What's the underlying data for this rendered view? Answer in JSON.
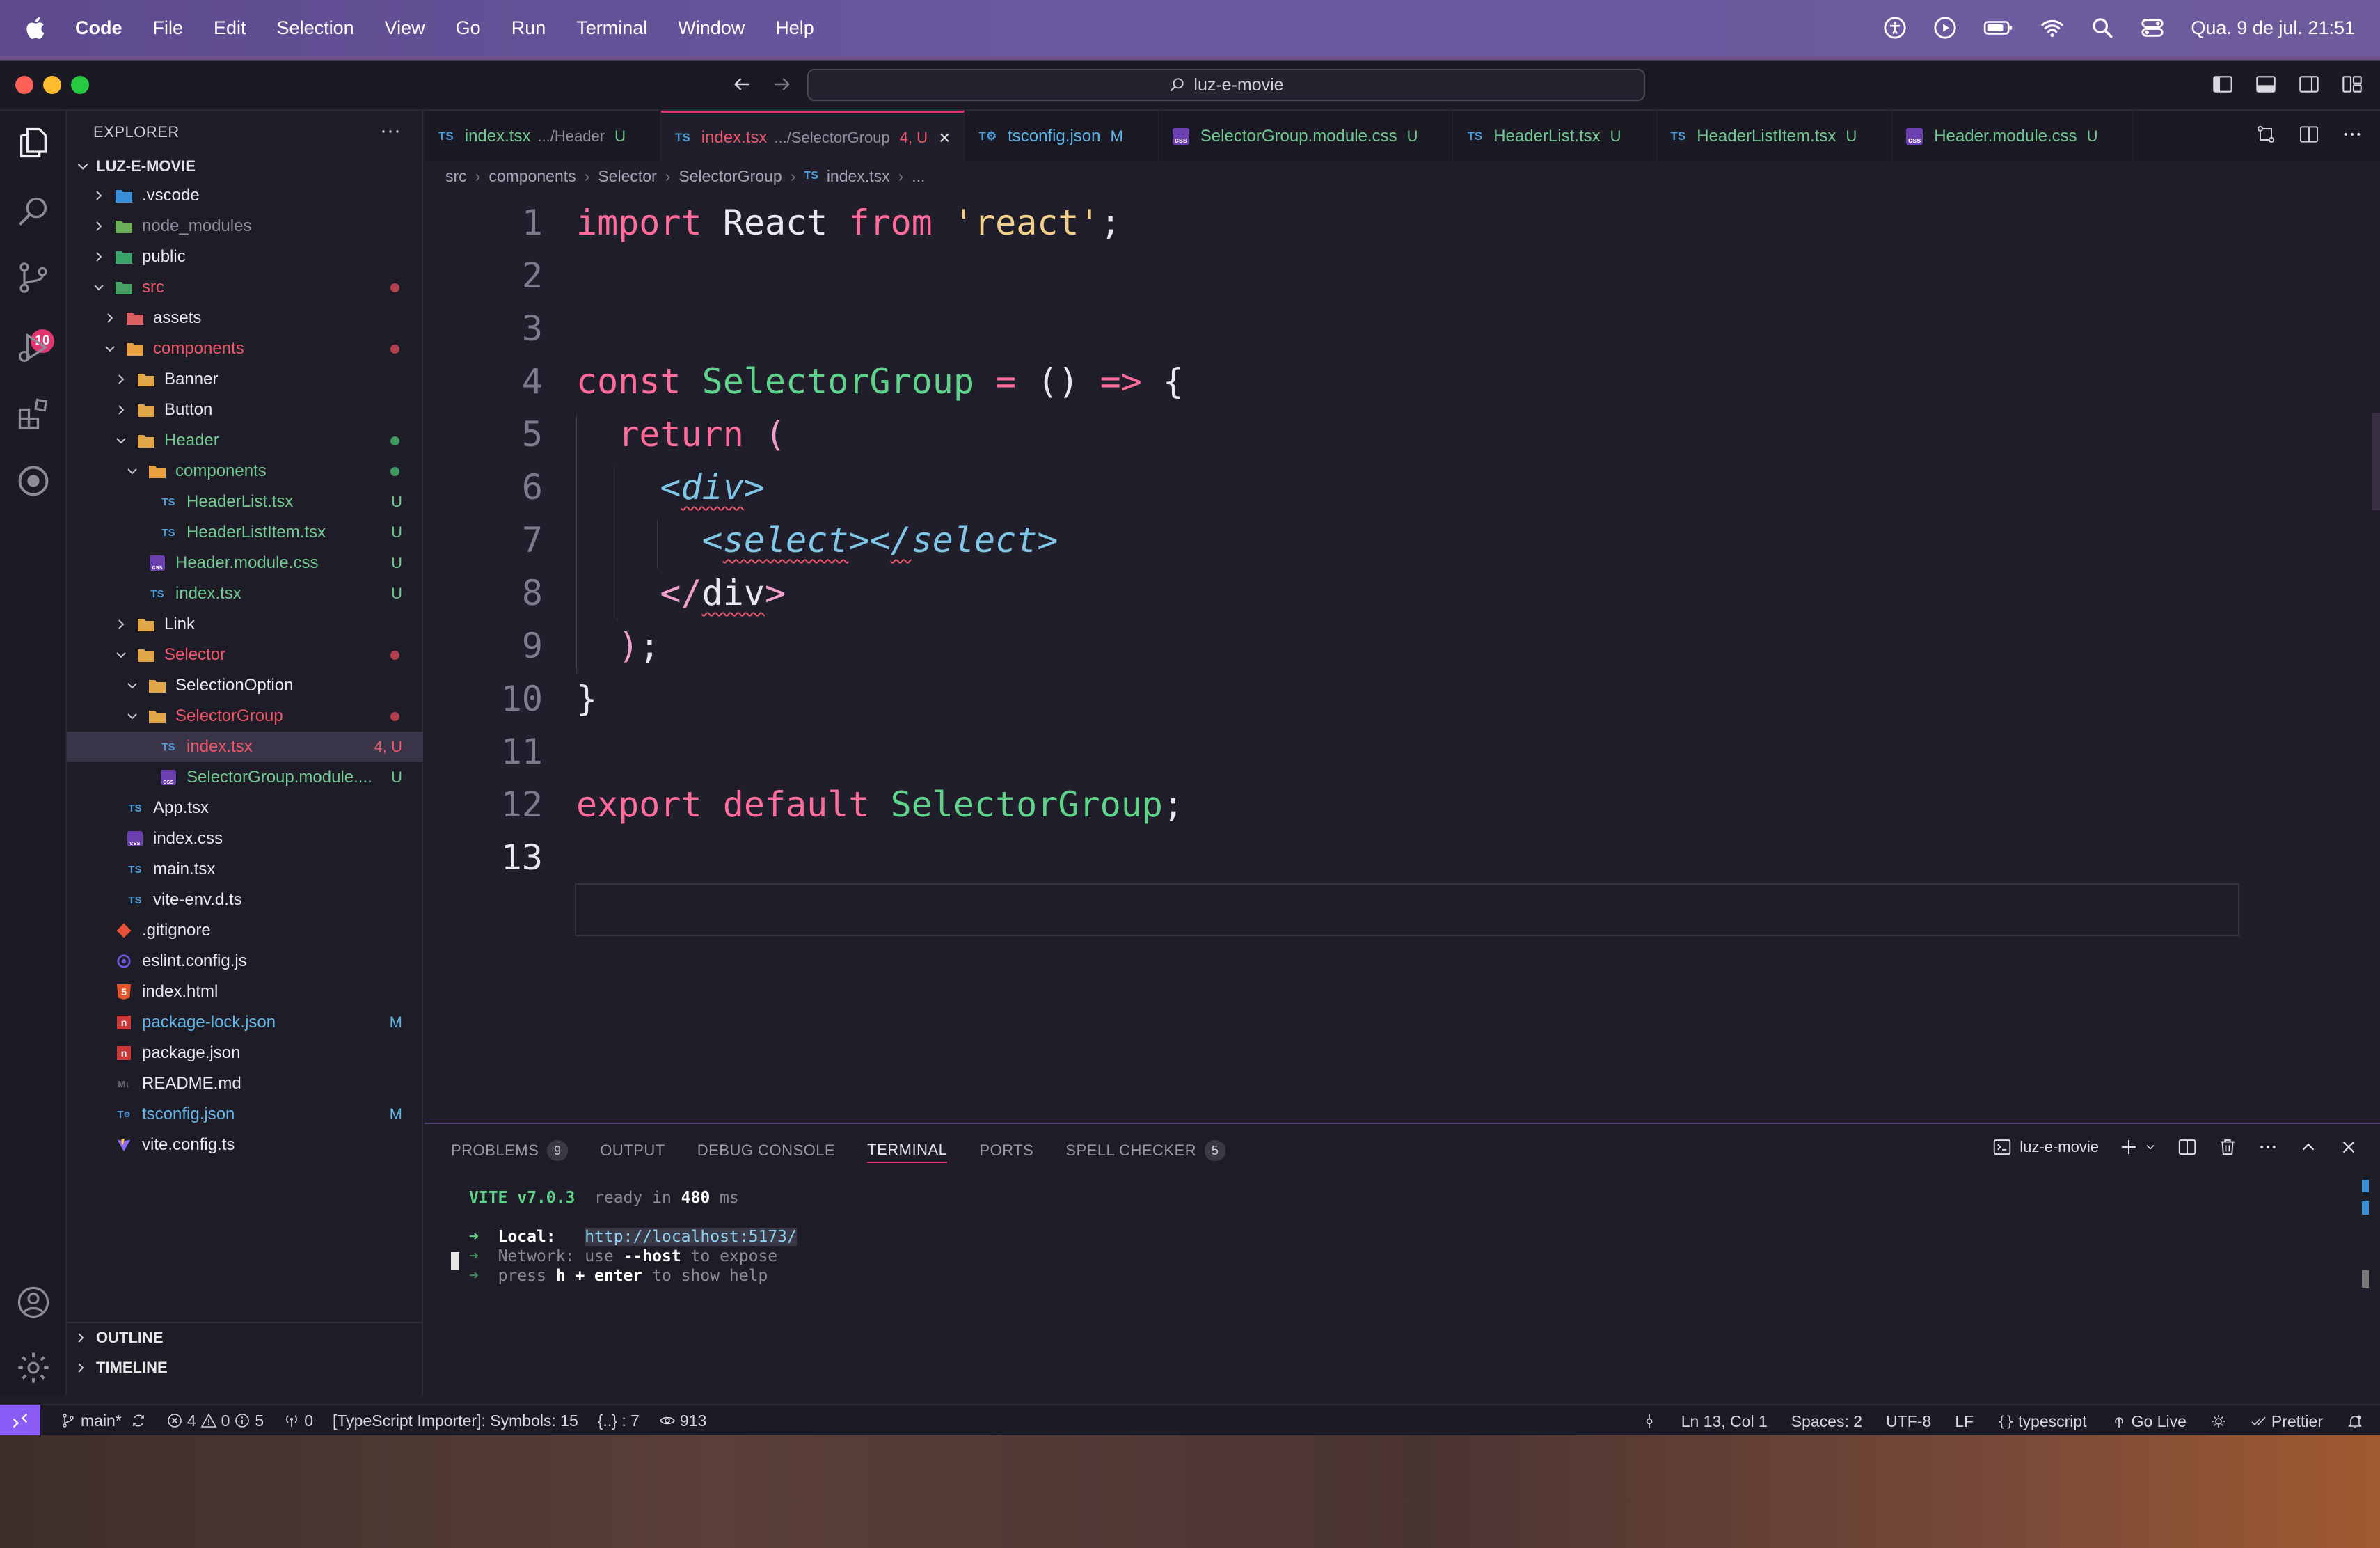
{
  "menubar": {
    "items": [
      "Code",
      "File",
      "Edit",
      "Selection",
      "View",
      "Go",
      "Run",
      "Terminal",
      "Window",
      "Help"
    ],
    "clock": "Qua. 9 de jul.  21:51"
  },
  "titlebar": {
    "command_center": "luz-e-movie"
  },
  "activity": {
    "scm_badge": "10"
  },
  "sidebar": {
    "title": "EXPLORER",
    "more": "···",
    "project": "LUZ-E-MOVIE",
    "outline": "OUTLINE",
    "timeline": "TIMELINE",
    "tree": [
      {
        "label": ".vscode",
        "type": "folder",
        "icon": "vscode-folder-icon",
        "depth": 0,
        "open": false
      },
      {
        "label": "node_modules",
        "type": "folder",
        "icon": "node-folder-icon",
        "depth": 0,
        "open": false,
        "dim": true
      },
      {
        "label": "public",
        "type": "folder",
        "icon": "public-folder-icon",
        "depth": 0,
        "open": false
      },
      {
        "label": "src",
        "type": "folder",
        "icon": "src-folder-icon",
        "depth": 0,
        "open": true,
        "color": "err",
        "dot": "err"
      },
      {
        "label": "assets",
        "type": "folder",
        "icon": "assets-folder-icon",
        "depth": 1,
        "open": false
      },
      {
        "label": "components",
        "type": "folder",
        "icon": "components-folder-icon",
        "depth": 1,
        "open": true,
        "color": "err",
        "dot": "err"
      },
      {
        "label": "Banner",
        "type": "folder",
        "icon": "folder-icon",
        "depth": 2,
        "open": false
      },
      {
        "label": "Button",
        "type": "folder",
        "icon": "folder-icon",
        "depth": 2,
        "open": false
      },
      {
        "label": "Header",
        "type": "folder",
        "icon": "folder-open-icon",
        "depth": 2,
        "open": true,
        "color": "git",
        "dot": "git"
      },
      {
        "label": "components",
        "type": "folder",
        "icon": "components-folder-icon",
        "depth": 3,
        "open": true,
        "color": "git",
        "dot": "git"
      },
      {
        "label": "HeaderList.tsx",
        "type": "ts",
        "icon": "typescript-file-icon",
        "depth": 4,
        "color": "git",
        "status": "U"
      },
      {
        "label": "HeaderListItem.tsx",
        "type": "ts",
        "icon": "typescript-file-icon",
        "depth": 4,
        "color": "git",
        "status": "U"
      },
      {
        "label": "Header.module.css",
        "type": "css",
        "icon": "css-file-icon",
        "depth": 3,
        "color": "git",
        "status": "U"
      },
      {
        "label": "index.tsx",
        "type": "ts",
        "icon": "typescript-file-icon",
        "depth": 3,
        "color": "git",
        "status": "U"
      },
      {
        "label": "Link",
        "type": "folder",
        "icon": "folder-icon",
        "depth": 2,
        "open": false
      },
      {
        "label": "Selector",
        "type": "folder",
        "icon": "folder-open-icon",
        "depth": 2,
        "open": true,
        "color": "err",
        "dot": "err"
      },
      {
        "label": "SelectionOption",
        "type": "folder",
        "icon": "folder-open-icon",
        "depth": 3,
        "open": true
      },
      {
        "label": "SelectorGroup",
        "type": "folder",
        "icon": "folder-open-icon",
        "depth": 3,
        "open": true,
        "color": "err",
        "dot": "err"
      },
      {
        "label": "index.tsx",
        "type": "ts",
        "icon": "typescript-file-icon",
        "depth": 4,
        "color": "err",
        "status": "4, U",
        "selected": true
      },
      {
        "label": "SelectorGroup.module....",
        "type": "css",
        "icon": "css-file-icon",
        "depth": 4,
        "color": "git",
        "status": "U"
      },
      {
        "label": "App.tsx",
        "type": "ts",
        "icon": "typescript-file-icon",
        "depth": 1
      },
      {
        "label": "index.css",
        "type": "css",
        "icon": "css-file-icon",
        "depth": 1
      },
      {
        "label": "main.tsx",
        "type": "ts",
        "icon": "typescript-file-icon",
        "depth": 1
      },
      {
        "label": "vite-env.d.ts",
        "type": "ts",
        "icon": "typescript-file-icon",
        "depth": 1
      },
      {
        "label": ".gitignore",
        "type": "git",
        "icon": "git-file-icon",
        "depth": 0
      },
      {
        "label": "eslint.config.js",
        "type": "eslint",
        "icon": "eslint-file-icon",
        "depth": 0
      },
      {
        "label": "index.html",
        "type": "html",
        "icon": "html-file-icon",
        "depth": 0
      },
      {
        "label": "package-lock.json",
        "type": "npm",
        "icon": "npm-file-icon",
        "depth": 0,
        "color": "mod",
        "status": "M"
      },
      {
        "label": "package.json",
        "type": "npm",
        "icon": "npm-file-icon",
        "depth": 0
      },
      {
        "label": "README.md",
        "type": "md",
        "icon": "markdown-file-icon",
        "depth": 0
      },
      {
        "label": "tsconfig.json",
        "type": "tsconfig",
        "icon": "tsconfig-file-icon",
        "depth": 0,
        "color": "mod",
        "status": "M"
      },
      {
        "label": "vite.config.ts",
        "type": "vite",
        "icon": "vite-file-icon",
        "depth": 0
      }
    ]
  },
  "tabs": [
    {
      "label": "index.tsx",
      "desc": ".../Header",
      "status": "U",
      "kind": "ts",
      "color": "git"
    },
    {
      "label": "index.tsx",
      "desc": ".../SelectorGroup",
      "status": "4, U",
      "kind": "ts",
      "color": "err",
      "active": true
    },
    {
      "label": "tsconfig.json",
      "desc": "",
      "status": "M",
      "kind": "tsconfig",
      "color": "mod"
    },
    {
      "label": "SelectorGroup.module.css",
      "desc": "",
      "status": "U",
      "kind": "css",
      "color": "git"
    },
    {
      "label": "HeaderList.tsx",
      "desc": "",
      "status": "U",
      "kind": "ts",
      "color": "git"
    },
    {
      "label": "HeaderListItem.tsx",
      "desc": "",
      "status": "U",
      "kind": "ts",
      "color": "git"
    },
    {
      "label": "Header.module.css",
      "desc": "",
      "status": "U",
      "kind": "css",
      "color": "git"
    }
  ],
  "breadcrumb": [
    "src",
    "components",
    "Selector",
    "SelectorGroup",
    "index.tsx",
    "..."
  ],
  "code": {
    "line_numbers": [
      "1",
      "2",
      "3",
      "4",
      "5",
      "6",
      "7",
      "8",
      "9",
      "10",
      "11",
      "12",
      "13"
    ],
    "current_line": "13"
  },
  "panel": {
    "tabs": [
      {
        "label": "PROBLEMS",
        "count": "9"
      },
      {
        "label": "OUTPUT",
        "count": ""
      },
      {
        "label": "DEBUG CONSOLE",
        "count": ""
      },
      {
        "label": "TERMINAL",
        "count": "",
        "active": true
      },
      {
        "label": "PORTS",
        "count": ""
      },
      {
        "label": "SPELL CHECKER",
        "count": "5"
      }
    ],
    "terminal_name": "luz-e-movie",
    "terminal": {
      "vite": "VITE v7.0.3",
      "ready": "  ready in ",
      "ms_value": "480",
      "ms_unit": " ms",
      "local_label": "Local:",
      "local_url": "http://localhost:5173/",
      "network_label": "Network:",
      "network_pre": " use ",
      "network_flag": "--host",
      "network_post": " to expose",
      "press_pre": "press ",
      "press_key": "h + enter",
      "press_post": " to show help"
    }
  },
  "status": {
    "branch": "main*",
    "errors": "4",
    "warnings": "0",
    "info": "5",
    "ports": "0",
    "importer": "[TypeScript Importer]: Symbols: 15",
    "snippets": "{..} : 7",
    "watch": "913",
    "position": "Ln 13, Col 1",
    "spaces": "Spaces: 2",
    "encoding": "UTF-8",
    "eol": "LF",
    "language": "typescript",
    "golive": "Go Live",
    "prettier": "Prettier"
  },
  "colors": {
    "accent": "#e0356f",
    "git_untracked": "#73c991",
    "modified": "#5fb6e6",
    "error": "#f0566a",
    "remote": "#8b5cf6"
  }
}
